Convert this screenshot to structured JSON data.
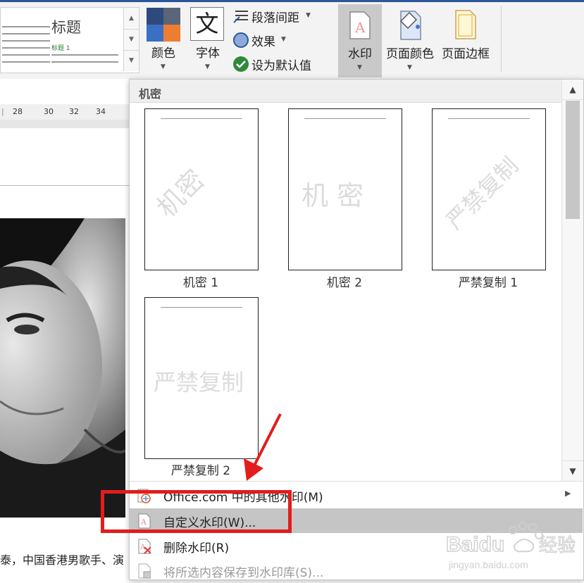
{
  "ribbon": {
    "style_gallery": {
      "title": "标题",
      "subtitle": "标题 1"
    },
    "colors_label": "颜色",
    "fonts_label": "字体",
    "fonts_glyph": "文",
    "paragraph_spacing_label": "段落间距",
    "effects_label": "效果",
    "set_default_label": "设为默认值",
    "watermark_label": "水印",
    "page_color_label": "页面颜色",
    "page_borders_label": "页面边框",
    "watermark_icon_letter": "A"
  },
  "ruler": {
    "ticks": [
      "28",
      "30",
      "32",
      "34"
    ]
  },
  "document": {
    "visible_text": "泰，中国香港男歌手、演"
  },
  "watermark_panel": {
    "section_title": "机密",
    "thumbnails": [
      {
        "label": "机密 1",
        "text": "机密",
        "style": "diagonal"
      },
      {
        "label": "机密 2",
        "text": "机 密",
        "style": "horizontal"
      },
      {
        "label": "严禁复制 1",
        "text": "严禁复制",
        "style": "diagonal"
      },
      {
        "label": "严禁复制 2",
        "text": "严禁复制",
        "style": "horizontal"
      }
    ],
    "menu": {
      "more_from_office": "Office.com 中的其他水印(M)",
      "custom": "自定义水印(W)...",
      "remove": "删除水印(R)",
      "save_selection": "将所选内容保存到水印库(S)..."
    }
  },
  "colors": {
    "ribbon_accent": "#2b579a",
    "highlight": "#c5c5c5",
    "annotation_red": "#e31c1c"
  },
  "site_watermark": {
    "brand": "Baidu",
    "brand_cn": "经验",
    "url": "jingyan.baidu.com"
  }
}
